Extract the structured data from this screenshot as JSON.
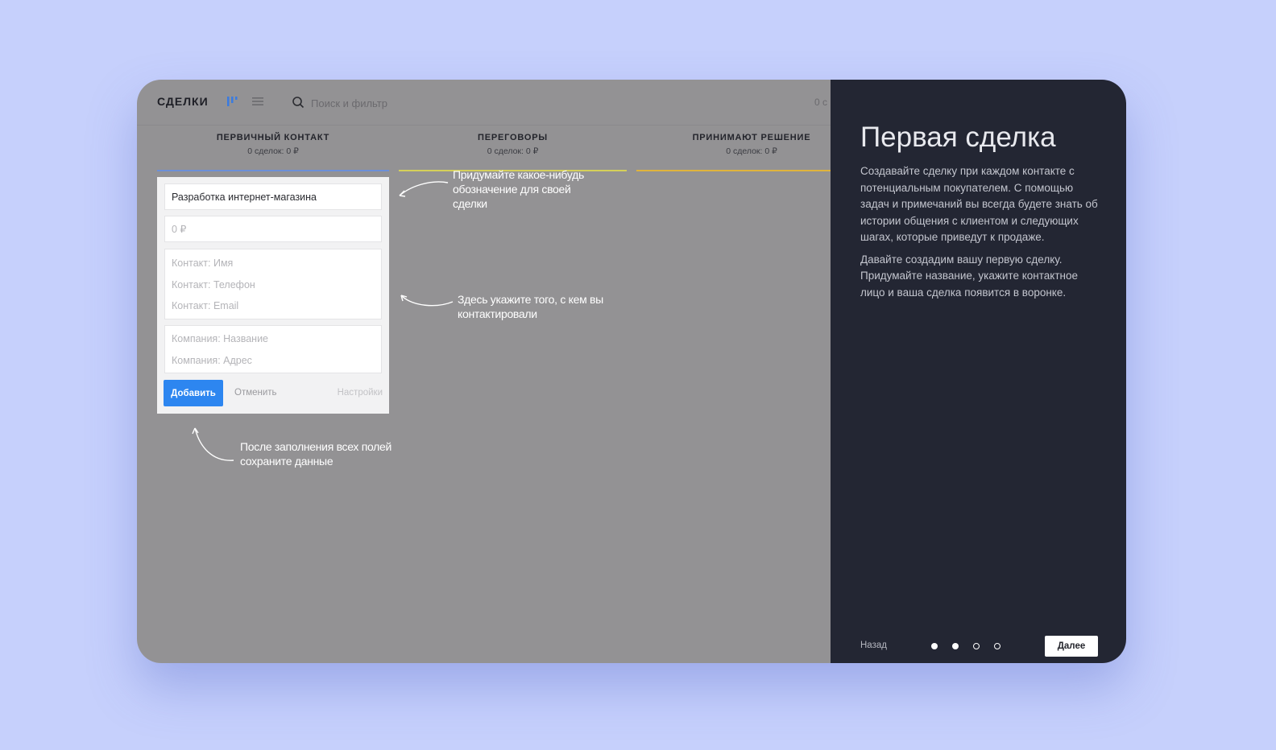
{
  "header": {
    "title": "СДЕЛКИ",
    "search_placeholder": "Поиск и фильтр",
    "right_text": "0 с"
  },
  "stages": [
    {
      "title": "ПЕРВИЧНЫЙ КОНТАКТ",
      "summary": "0 сделок: 0 ₽",
      "color": "#6c8fd8"
    },
    {
      "title": "ПЕРЕГОВОРЫ",
      "summary": "0 сделок: 0 ₽",
      "color": "#d6d05a"
    },
    {
      "title": "ПРИНИМАЮТ РЕШЕНИЕ",
      "summary": "0 сделок: 0 ₽",
      "color": "#e0b43c"
    }
  ],
  "form": {
    "name_value": "Разработка интернет-магазина",
    "price_placeholder": "0 ₽",
    "contact_name_placeholder": "Контакт: Имя",
    "contact_phone_placeholder": "Контакт: Телефон",
    "contact_email_placeholder": "Контакт: Email",
    "company_name_placeholder": "Компания: Название",
    "company_address_placeholder": "Компания: Адрес",
    "add_label": "Добавить",
    "cancel_label": "Отменить",
    "settings_label": "Настройки"
  },
  "hints": {
    "name_hint": "Придумайте какое-нибудь обозначение для своей сделки",
    "contact_hint": "Здесь укажите того, с кем вы контактировали",
    "save_hint": "После заполнения всех полей сохраните данные"
  },
  "panel": {
    "title": "Первая сделка",
    "paragraph_1": "Создавайте сделку при каждом контакте с потенциальным покупателем. С помощью задач и примечаний вы всегда будете знать об истории общения с клиентом и следующих шагах, которые приведут к продаже.",
    "paragraph_2": "Давайте создадим вашу первую сделку. Придумайте название, укажите контактное лицо и ваша сделка появится в воронке.",
    "back_label": "Назад",
    "next_label": "Далее",
    "steps_total": 4,
    "steps_filled": 2
  },
  "colors": {
    "accent": "#2d86f0",
    "page_background": "#c6d0fc",
    "panel_background": "#232633",
    "board_overlay": "#939294"
  }
}
